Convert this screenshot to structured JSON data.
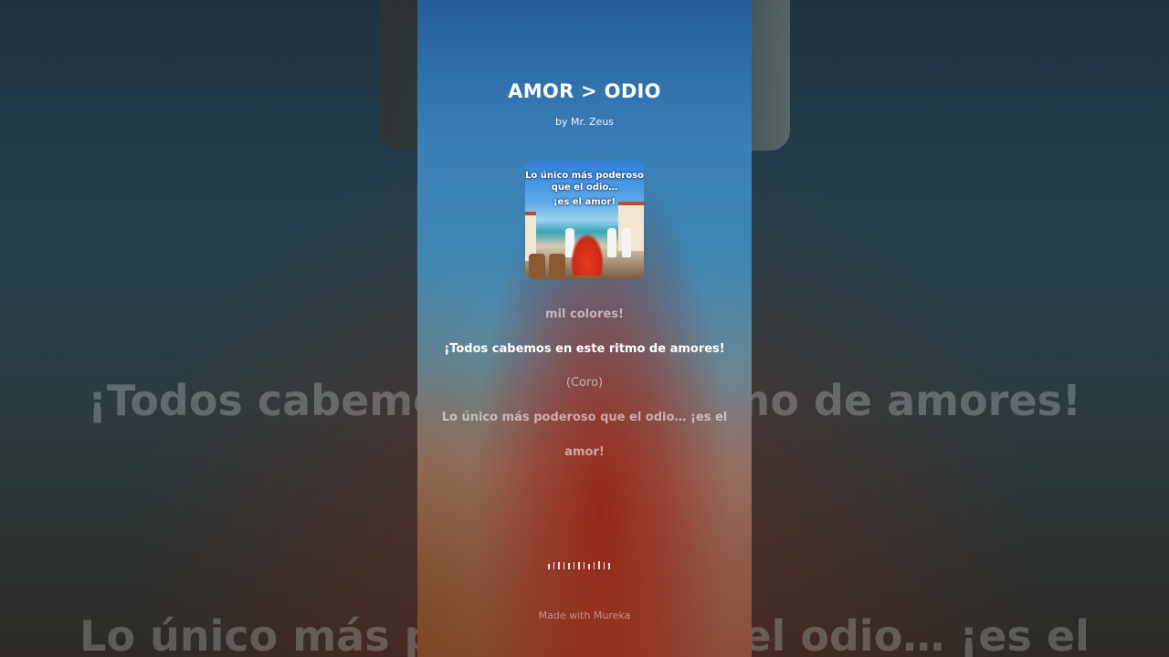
{
  "background": {
    "lyric_line_1": "¡Todos cabemos en este ritmo de amores!",
    "lyric_line_2": "Lo único más poderoso que el odio… ¡es el"
  },
  "song": {
    "title": "AMOR > ODIO",
    "artist": "by Mr. Zeus"
  },
  "cover": {
    "text_line_1": "Lo único más poderoso",
    "text_line_2": "que el odio…",
    "text_line_3": "¡es el amor!"
  },
  "lyrics": [
    "mil colores!",
    "¡Todos cabemos en este ritmo de amores!",
    "(Coro)",
    "Lo único más poderoso que el odio… ¡es el",
    "amor!"
  ],
  "active_lyric_index": 1,
  "footer": {
    "made_with": "Made with Mureka"
  },
  "colors": {
    "accent_red": "#c82a16",
    "sky_blue": "#3a7fb8"
  }
}
